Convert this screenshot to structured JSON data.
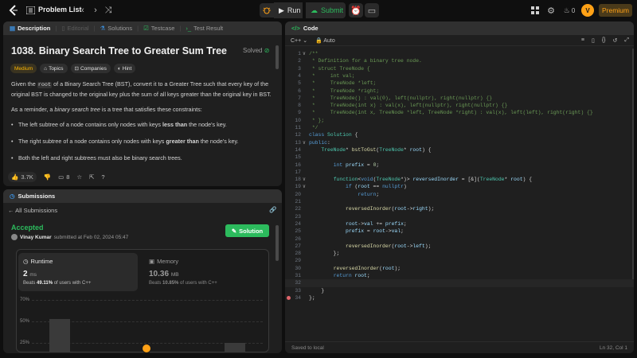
{
  "topbar": {
    "title": "Problem List",
    "run": "Run",
    "submit": "Submit",
    "streak": "0",
    "premium": "Premium"
  },
  "problem": {
    "tabs": [
      "Description",
      "Editorial",
      "Solutions",
      "Testcase",
      "Test Result"
    ],
    "title": "1038. Binary Search Tree to Greater Sum Tree",
    "solved": "Solved",
    "chips": [
      "Medium",
      "Topics",
      "Companies",
      "Hint"
    ],
    "para1_a": "Given the ",
    "para1_code": "root",
    "para1_b": " of a Binary Search Tree (BST), convert it to a Greater Tree such that every key of the original BST is changed to the original key plus the sum of all keys greater than the original key in BST.",
    "para2_a": "As a reminder, a ",
    "para2_em": "binary search tree",
    "para2_b": " is a tree that satisfies these constraints:",
    "bullet1_a": "The left subtree of a node contains only nodes with keys ",
    "bullet1_b": "less than",
    "bullet1_c": " the node's key.",
    "bullet2_a": "The right subtree of a node contains only nodes with keys ",
    "bullet2_b": "greater than",
    "bullet2_c": " the node's key.",
    "bullet3": "Both the left and right subtrees must also be binary search trees.",
    "likes": "3.7K",
    "comments": "8"
  },
  "submissions": {
    "header": "Submissions",
    "back": "All Submissions",
    "status": "Accepted",
    "user": "Vinay Kumar",
    "submitted_at": "submitted at Feb 02, 2024 05:47",
    "solution_btn": "Solution",
    "runtime_label": "Runtime",
    "runtime_value": "2",
    "runtime_unit": "ms",
    "runtime_beats_a": "Beats ",
    "runtime_beats_pct": "49.11%",
    "runtime_beats_b": " of users with C++",
    "memory_label": "Memory",
    "memory_value": "10.36",
    "memory_unit": "MB",
    "memory_beats_a": "Beats ",
    "memory_beats_pct": "10.85%",
    "memory_beats_b": " of users with C++",
    "axis": [
      "70%",
      "50%",
      "25%"
    ],
    "bar_levels": [
      50,
      25
    ]
  },
  "editor": {
    "header": "Code",
    "lang": "C++",
    "auto": "Auto",
    "saved": "Saved to local",
    "cursor": "Ln 32, Col 1",
    "lines": [
      {
        "n": "1",
        "f": "∨",
        "t": [
          [
            "cm",
            "/**"
          ]
        ]
      },
      {
        "n": "2",
        "t": [
          [
            "cm",
            " * Definition for a binary tree node."
          ]
        ]
      },
      {
        "n": "3",
        "t": [
          [
            "cm",
            " * struct TreeNode {"
          ]
        ]
      },
      {
        "n": "4",
        "t": [
          [
            "cm",
            " *     int val;"
          ]
        ]
      },
      {
        "n": "5",
        "t": [
          [
            "cm",
            " *     TreeNode *left;"
          ]
        ]
      },
      {
        "n": "6",
        "t": [
          [
            "cm",
            " *     TreeNode *right;"
          ]
        ]
      },
      {
        "n": "7",
        "t": [
          [
            "cm",
            " *     TreeNode() : val(0), left(nullptr), right(nullptr) {}"
          ]
        ]
      },
      {
        "n": "8",
        "t": [
          [
            "cm",
            " *     TreeNode(int x) : val(x), left(nullptr), right(nullptr) {}"
          ]
        ]
      },
      {
        "n": "9",
        "t": [
          [
            "cm",
            " *     TreeNode(int x, TreeNode *left, TreeNode *right) : val(x), left(left), right(right) {}"
          ]
        ]
      },
      {
        "n": "10",
        "t": [
          [
            "cm",
            " * };"
          ]
        ]
      },
      {
        "n": "11",
        "t": [
          [
            "cm",
            " */"
          ]
        ]
      },
      {
        "n": "12",
        "t": [
          [
            "kw",
            "class "
          ],
          [
            "ty",
            "Solution"
          ],
          [
            "",
            " {"
          ]
        ]
      },
      {
        "n": "13",
        "f": "∨",
        "t": [
          [
            "kw",
            "public"
          ],
          [
            "",
            ":"
          ]
        ]
      },
      {
        "n": "14",
        "t": [
          [
            "",
            "    "
          ],
          [
            "ty",
            "TreeNode"
          ],
          [
            "",
            "* "
          ],
          [
            "fn",
            "bstToGst"
          ],
          [
            "",
            "("
          ],
          [
            "ty",
            "TreeNode"
          ],
          [
            "",
            "* "
          ],
          [
            "vr",
            "root"
          ],
          [
            "",
            ") {"
          ]
        ]
      },
      {
        "n": "15",
        "t": [
          [
            "",
            ""
          ]
        ]
      },
      {
        "n": "16",
        "t": [
          [
            "",
            "        "
          ],
          [
            "kw",
            "int "
          ],
          [
            "vr",
            "prefix"
          ],
          [
            "",
            " = "
          ],
          [
            "nu",
            "0"
          ],
          [
            "",
            ";"
          ]
        ]
      },
      {
        "n": "17",
        "t": [
          [
            "",
            ""
          ]
        ]
      },
      {
        "n": "18",
        "f": "∨",
        "t": [
          [
            "",
            "        "
          ],
          [
            "ty",
            "function"
          ],
          [
            "",
            "<"
          ],
          [
            "kw",
            "void"
          ],
          [
            "",
            "("
          ],
          [
            "ty",
            "TreeNode"
          ],
          [
            "",
            "*)> "
          ],
          [
            "vr",
            "reversedInorder"
          ],
          [
            "",
            " = [&]("
          ],
          [
            "ty",
            "TreeNode"
          ],
          [
            "",
            "* "
          ],
          [
            "vr",
            "root"
          ],
          [
            "",
            ") {"
          ]
        ]
      },
      {
        "n": "19",
        "f": "∨",
        "t": [
          [
            "",
            "            "
          ],
          [
            "kw",
            "if"
          ],
          [
            "",
            " ("
          ],
          [
            "vr",
            "root"
          ],
          [
            "",
            " == "
          ],
          [
            "kw",
            "nullptr"
          ],
          [
            "",
            ")"
          ]
        ]
      },
      {
        "n": "20",
        "t": [
          [
            "",
            "                "
          ],
          [
            "kw",
            "return"
          ],
          [
            "",
            ";"
          ]
        ]
      },
      {
        "n": "21",
        "t": [
          [
            "",
            ""
          ]
        ]
      },
      {
        "n": "22",
        "t": [
          [
            "",
            "            "
          ],
          [
            "fn",
            "reversedInorder"
          ],
          [
            "",
            "("
          ],
          [
            "vr",
            "root"
          ],
          [
            "",
            "->"
          ],
          [
            "vr",
            "right"
          ],
          [
            "",
            ");"
          ]
        ]
      },
      {
        "n": "23",
        "t": [
          [
            "",
            ""
          ]
        ]
      },
      {
        "n": "24",
        "t": [
          [
            "",
            "            "
          ],
          [
            "vr",
            "root"
          ],
          [
            "",
            "->"
          ],
          [
            "vr",
            "val"
          ],
          [
            "",
            " += "
          ],
          [
            "vr",
            "prefix"
          ],
          [
            "",
            ";"
          ]
        ]
      },
      {
        "n": "25",
        "t": [
          [
            "",
            "            "
          ],
          [
            "vr",
            "prefix"
          ],
          [
            "",
            " = "
          ],
          [
            "vr",
            "root"
          ],
          [
            "",
            "->"
          ],
          [
            "vr",
            "val"
          ],
          [
            "",
            ";"
          ]
        ]
      },
      {
        "n": "26",
        "t": [
          [
            "",
            ""
          ]
        ]
      },
      {
        "n": "27",
        "t": [
          [
            "",
            "            "
          ],
          [
            "fn",
            "reversedInorder"
          ],
          [
            "",
            "("
          ],
          [
            "vr",
            "root"
          ],
          [
            "",
            "->"
          ],
          [
            "vr",
            "left"
          ],
          [
            "",
            ");"
          ]
        ]
      },
      {
        "n": "28",
        "t": [
          [
            "",
            "        };"
          ]
        ]
      },
      {
        "n": "29",
        "t": [
          [
            "",
            ""
          ]
        ]
      },
      {
        "n": "30",
        "t": [
          [
            "",
            "        "
          ],
          [
            "fn",
            "reversedInorder"
          ],
          [
            "",
            "("
          ],
          [
            "vr",
            "root"
          ],
          [
            "",
            ");"
          ]
        ]
      },
      {
        "n": "31",
        "t": [
          [
            "",
            "        "
          ],
          [
            "kw",
            "return "
          ],
          [
            "vr",
            "root"
          ],
          [
            "",
            ";"
          ]
        ]
      },
      {
        "n": "32",
        "t": [
          [
            "",
            ""
          ]
        ]
      },
      {
        "n": "33",
        "t": [
          [
            "",
            "    }"
          ]
        ]
      },
      {
        "n": "34",
        "t": [
          [
            "",
            "};"
          ]
        ]
      }
    ]
  },
  "colors": {
    "accent": "#ffa116",
    "green": "#2cbb5d",
    "panel": "#1f1f1f",
    "panel_head": "#303030"
  }
}
